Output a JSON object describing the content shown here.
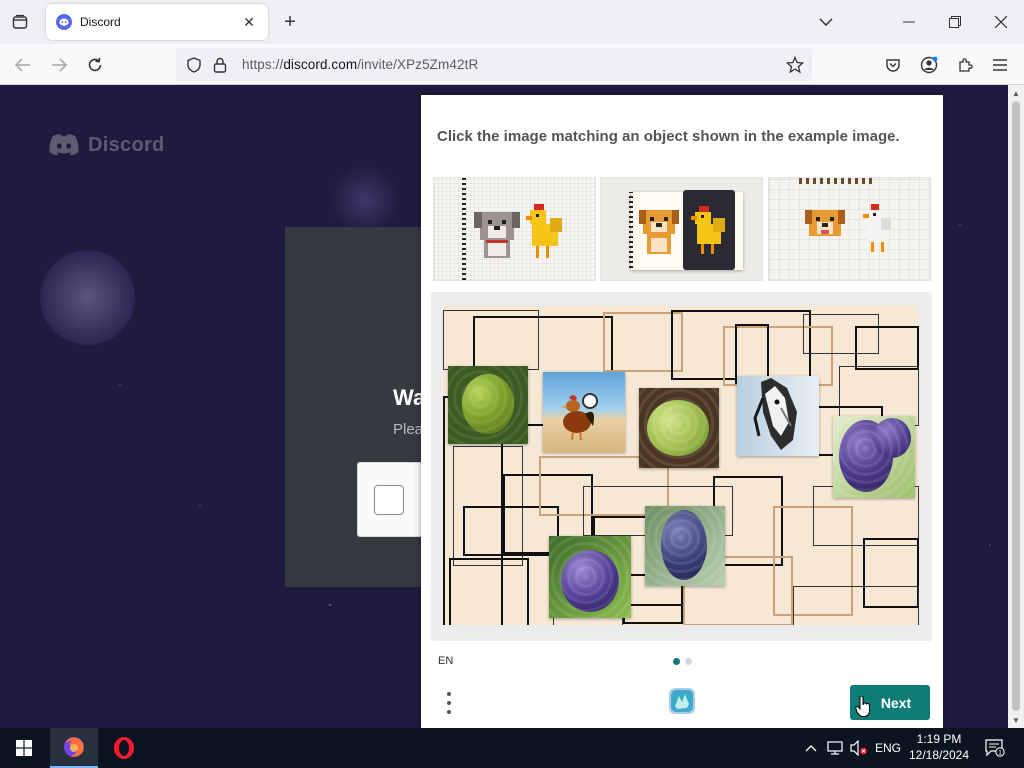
{
  "browser": {
    "tab_title": "Discord",
    "url_prefix": "https://",
    "url_domain": "discord.com",
    "url_path": "/invite/XPz5Zm42tR"
  },
  "page": {
    "logo_text": "Discord",
    "card_title_partial": "Wa",
    "card_sub_partial": "Plea"
  },
  "challenge": {
    "prompt": "Click the image matching an object shown in the example image.",
    "language": "EN",
    "next_label": "Next",
    "accent": "#0f7d75",
    "example_images": [
      {
        "name": "example-dog-chicken-1",
        "animals": [
          "dog",
          "chicken"
        ]
      },
      {
        "name": "example-dog-chicken-2",
        "animals": [
          "dog",
          "chicken"
        ]
      },
      {
        "name": "example-dog-chicken-3",
        "animals": [
          "dog",
          "chicken"
        ]
      }
    ],
    "canvas_photos": [
      "green grapes",
      "rooster on beach",
      "green grapes",
      "horse",
      "purple grapes",
      "purple grapes",
      "purple grapes"
    ]
  },
  "taskbar": {
    "language": "ENG",
    "time": "1:19 PM",
    "date": "12/18/2024",
    "notification_count": "1"
  },
  "colors": {
    "discord_blurple": "#5865f2",
    "page_bg": "#1f1b3e",
    "taskbar_bg": "#0b1521"
  }
}
